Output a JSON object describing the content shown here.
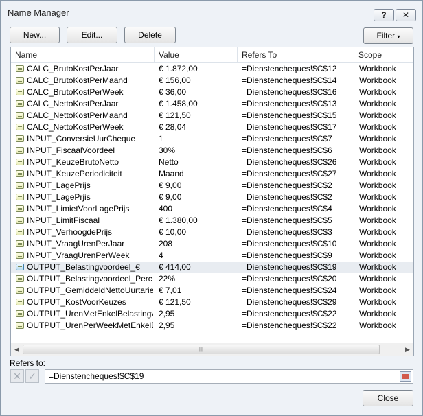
{
  "window": {
    "title": "Name Manager",
    "help_label": "?",
    "close_label": "✕"
  },
  "toolbar": {
    "new_label": "New...",
    "edit_label": "Edit...",
    "delete_label": "Delete",
    "filter_label": "Filter"
  },
  "columns": [
    "Name",
    "Value",
    "Refers To",
    "Scope"
  ],
  "rows": [
    {
      "name": "CALC_BrutoKostPerJaar",
      "value": "€ 1.872,00",
      "refers_to": "=Dienstencheques!$C$12",
      "scope": "Workbook"
    },
    {
      "name": "CALC_BrutoKostPerMaand",
      "value": "€ 156,00",
      "refers_to": "=Dienstencheques!$C$14",
      "scope": "Workbook"
    },
    {
      "name": "CALC_BrutoKostPerWeek",
      "value": "€ 36,00",
      "refers_to": "=Dienstencheques!$C$16",
      "scope": "Workbook"
    },
    {
      "name": "CALC_NettoKostPerJaar",
      "value": "€ 1.458,00",
      "refers_to": "=Dienstencheques!$C$13",
      "scope": "Workbook"
    },
    {
      "name": "CALC_NettoKostPerMaand",
      "value": "€ 121,50",
      "refers_to": "=Dienstencheques!$C$15",
      "scope": "Workbook"
    },
    {
      "name": "CALC_NettoKostPerWeek",
      "value": "€ 28,04",
      "refers_to": "=Dienstencheques!$C$17",
      "scope": "Workbook"
    },
    {
      "name": "INPUT_ConversieUurCheque",
      "value": "1",
      "refers_to": "=Dienstencheques!$C$7",
      "scope": "Workbook"
    },
    {
      "name": "INPUT_FiscaalVoordeel",
      "value": "30%",
      "refers_to": "=Dienstencheques!$C$6",
      "scope": "Workbook"
    },
    {
      "name": "INPUT_KeuzeBrutoNetto",
      "value": "Netto",
      "refers_to": "=Dienstencheques!$C$26",
      "scope": "Workbook"
    },
    {
      "name": "INPUT_KeuzePeriodiciteit",
      "value": "Maand",
      "refers_to": "=Dienstencheques!$C$27",
      "scope": "Workbook"
    },
    {
      "name": "INPUT_LagePrijs",
      "value": "€ 9,00",
      "refers_to": "=Dienstencheques!$C$2",
      "scope": "Workbook"
    },
    {
      "name": "INPUT_LagePrjis",
      "value": "€ 9,00",
      "refers_to": "=Dienstencheques!$C$2",
      "scope": "Workbook"
    },
    {
      "name": "INPUT_LimietVoorLagePrijs",
      "value": "400",
      "refers_to": "=Dienstencheques!$C$4",
      "scope": "Workbook"
    },
    {
      "name": "INPUT_LimitFiscaal",
      "value": "€ 1.380,00",
      "refers_to": "=Dienstencheques!$C$5",
      "scope": "Workbook"
    },
    {
      "name": "INPUT_VerhoogdePrijs",
      "value": "€ 10,00",
      "refers_to": "=Dienstencheques!$C$3",
      "scope": "Workbook"
    },
    {
      "name": "INPUT_VraagUrenPerJaar",
      "value": "208",
      "refers_to": "=Dienstencheques!$C$10",
      "scope": "Workbook"
    },
    {
      "name": "INPUT_VraagUrenPerWeek",
      "value": "4",
      "refers_to": "=Dienstencheques!$C$9",
      "scope": "Workbook"
    },
    {
      "name": "OUTPUT_Belastingvoordeel_€",
      "value": "€ 414,00",
      "refers_to": "=Dienstencheques!$C$19",
      "scope": "Workbook",
      "selected": true
    },
    {
      "name": "OUTPUT_Belastingvoordeel_Perc",
      "value": "22%",
      "refers_to": "=Dienstencheques!$C$20",
      "scope": "Workbook"
    },
    {
      "name": "OUTPUT_GemiddeldNettoUurtarief",
      "value": "€ 7,01",
      "refers_to": "=Dienstencheques!$C$24",
      "scope": "Workbook"
    },
    {
      "name": "OUTPUT_KostVoorKeuzes",
      "value": "€ 121,50",
      "refers_to": "=Dienstencheques!$C$29",
      "scope": "Workbook"
    },
    {
      "name": "OUTPUT_UrenMetEnkelBelastingv...",
      "value": "2,95",
      "refers_to": "=Dienstencheques!$C$22",
      "scope": "Workbook"
    },
    {
      "name": "OUTPUT_UrenPerWeekMetEnkelBe...",
      "value": "2,95",
      "refers_to": "=Dienstencheques!$C$22",
      "scope": "Workbook"
    }
  ],
  "refers_to": {
    "label": "Refers to:",
    "value": "=Dienstencheques!$C$19"
  },
  "footer": {
    "close_label": "Close"
  }
}
